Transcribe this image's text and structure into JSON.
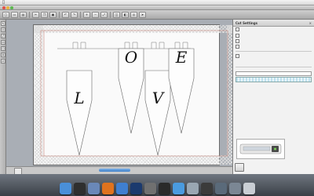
{
  "menubar": {
    "apple": "",
    "items": [
      "",
      "",
      "",
      "",
      "",
      "",
      "",
      ""
    ],
    "status": [
      "",
      "",
      ""
    ]
  },
  "window": {
    "title": ""
  },
  "toolbar": {
    "buttons": [
      "",
      "",
      "",
      "",
      "",
      "",
      "",
      "",
      "",
      "",
      "",
      "",
      "",
      ""
    ]
  },
  "canvas": {
    "letters": [
      "L",
      "O",
      "V",
      "E"
    ],
    "document_tab": "",
    "pennant_count": 4
  },
  "panel": {
    "title": "Cut Settings",
    "close": "×",
    "rows": [
      {
        "label": "",
        "checked": false
      },
      {
        "label": "",
        "checked": false
      },
      {
        "label": "",
        "checked": false
      },
      {
        "label": "",
        "checked": false
      }
    ],
    "send_label": "",
    "section_media": "",
    "media_fields": [
      "",
      "",
      ""
    ],
    "media_link": "",
    "section_speed": "",
    "cut_button": "",
    "cutter_status": ""
  },
  "dock": {
    "apps": [
      {
        "name": "finder",
        "color": "#4a8fd8"
      },
      {
        "name": "dashboard",
        "color": "#2f2f2f"
      },
      {
        "name": "mail",
        "color": "#6a88b8"
      },
      {
        "name": "firefox",
        "color": "#e0731e"
      },
      {
        "name": "itunes",
        "color": "#3f7fd0"
      },
      {
        "name": "photoshop",
        "color": "#1b3a6e"
      },
      {
        "name": "system-preferences",
        "color": "#707070"
      },
      {
        "name": "time-machine",
        "color": "#2a2a2a"
      },
      {
        "name": "safari",
        "color": "#4a9be0"
      },
      {
        "name": "preview",
        "color": "#9aa7b3"
      },
      {
        "name": "app-store",
        "color": "#3b3b3b"
      },
      {
        "name": "itunes-2",
        "color": "#5a6a7a"
      },
      {
        "name": "downloads",
        "color": "#7b8794"
      },
      {
        "name": "trash",
        "color": "#c9ced4"
      }
    ]
  },
  "colors": {
    "accent": "#3d7fc9",
    "mat_border": "#c9897f",
    "panel_bg": "#f2f2f2"
  }
}
